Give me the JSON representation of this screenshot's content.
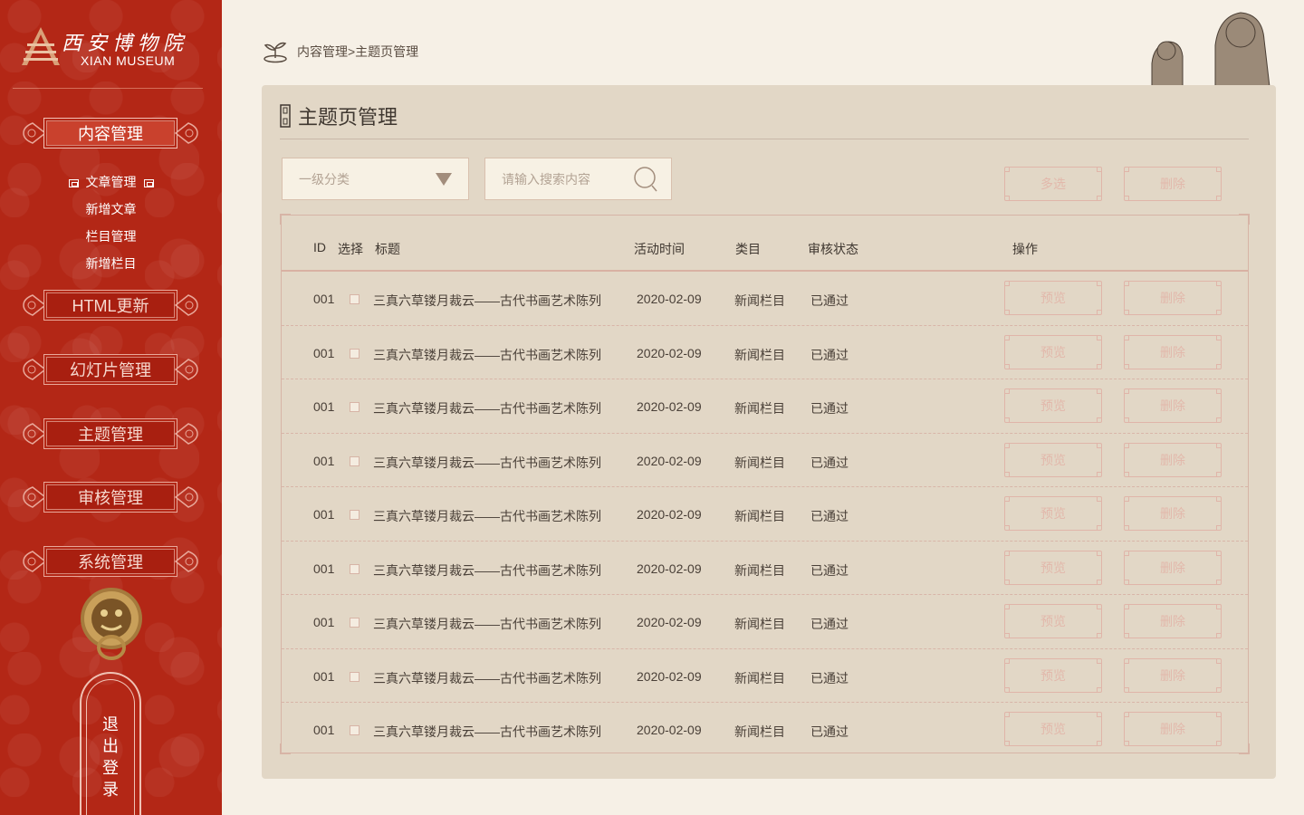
{
  "brand": {
    "cn": "西安博物院",
    "en": "XIAN MUSEUM"
  },
  "sidebar": {
    "sections": [
      {
        "label": "内容管理",
        "active": true
      },
      {
        "label": "HTML更新",
        "active": false
      },
      {
        "label": "幻灯片管理",
        "active": false
      },
      {
        "label": "主题管理",
        "active": false
      },
      {
        "label": "审核管理",
        "active": false
      },
      {
        "label": "系统管理",
        "active": false
      }
    ],
    "submenu": [
      "文章管理",
      "新增文章",
      "栏目管理",
      "新增栏目"
    ],
    "logout": [
      "退",
      "出",
      "登",
      "录"
    ]
  },
  "breadcrumb": "内容管理>主题页管理",
  "page": {
    "title": "主题页管理"
  },
  "filters": {
    "category_placeholder": "一级分类",
    "search_placeholder": "请输入搜索内容",
    "multi_select_label": "多选",
    "delete_label": "删除"
  },
  "table": {
    "headers": {
      "id": "ID",
      "select": "选择",
      "title": "标题",
      "time": "活动时间",
      "category": "类目",
      "status": "审核状态",
      "actions": "操作"
    },
    "rows": [
      {
        "id": "001",
        "title": "三真六草镂月裁云——古代书画艺术陈列",
        "time": "2020-02-09",
        "category": "新闻栏目",
        "status": "已通过",
        "preview": "预览",
        "delete": "删除"
      },
      {
        "id": "001",
        "title": "三真六草镂月裁云——古代书画艺术陈列",
        "time": "2020-02-09",
        "category": "新闻栏目",
        "status": "已通过",
        "preview": "预览",
        "delete": "删除"
      },
      {
        "id": "001",
        "title": "三真六草镂月裁云——古代书画艺术陈列",
        "time": "2020-02-09",
        "category": "新闻栏目",
        "status": "已通过",
        "preview": "预览",
        "delete": "删除"
      },
      {
        "id": "001",
        "title": "三真六草镂月裁云——古代书画艺术陈列",
        "time": "2020-02-09",
        "category": "新闻栏目",
        "status": "已通过",
        "preview": "预览",
        "delete": "删除"
      },
      {
        "id": "001",
        "title": "三真六草镂月裁云——古代书画艺术陈列",
        "time": "2020-02-09",
        "category": "新闻栏目",
        "status": "已通过",
        "preview": "预览",
        "delete": "删除"
      },
      {
        "id": "001",
        "title": "三真六草镂月裁云——古代书画艺术陈列",
        "time": "2020-02-09",
        "category": "新闻栏目",
        "status": "已通过",
        "preview": "预览",
        "delete": "删除"
      },
      {
        "id": "001",
        "title": "三真六草镂月裁云——古代书画艺术陈列",
        "time": "2020-02-09",
        "category": "新闻栏目",
        "status": "已通过",
        "preview": "预览",
        "delete": "删除"
      },
      {
        "id": "001",
        "title": "三真六草镂月裁云——古代书画艺术陈列",
        "time": "2020-02-09",
        "category": "新闻栏目",
        "status": "已通过",
        "preview": "预览",
        "delete": "删除"
      },
      {
        "id": "001",
        "title": "三真六草镂月裁云——古代书画艺术陈列",
        "time": "2020-02-09",
        "category": "新闻栏目",
        "status": "已通过",
        "preview": "预览",
        "delete": "删除"
      }
    ]
  },
  "colors": {
    "sidebar_bg": "#b32716",
    "panel_bg": "#e2d7c6",
    "page_bg": "#f6f0e6",
    "ghost_btn": "#e0b5a9"
  },
  "icons": {
    "logo": "pagoda-logo-icon",
    "breadcrumb": "sprout-icon",
    "search": "search-icon",
    "dropdown": "triangle-down-icon",
    "knocker": "door-knocker-icon",
    "decor": "stone-lions-icon"
  }
}
